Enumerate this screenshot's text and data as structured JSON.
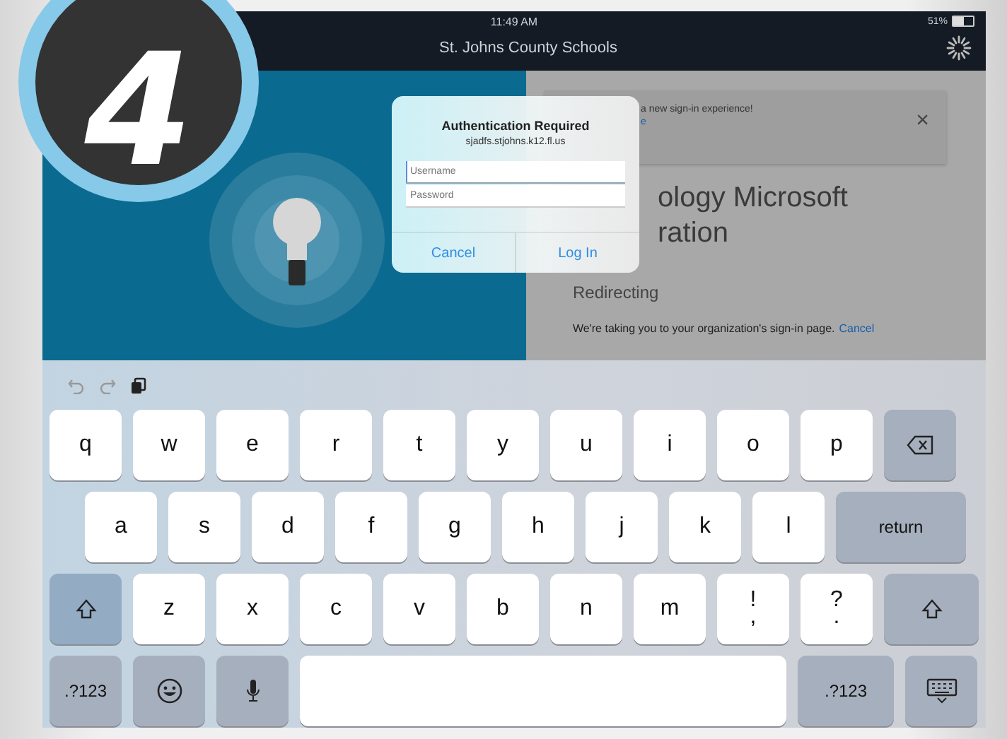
{
  "badge": {
    "label": "4"
  },
  "status_bar": {
    "time": "11:49 AM",
    "battery": "51%"
  },
  "browser": {
    "title": "St. Johns County Schools"
  },
  "page": {
    "banner": {
      "text": "a new sign-in experience!",
      "link": "e",
      "close": "×"
    },
    "heading_lines": [
      "ology Microsoft",
      "ration"
    ],
    "status": "Redirecting",
    "message": "We're taking you to your organization's sign-in page.",
    "cancel_link": "Cancel"
  },
  "dialog": {
    "title": "Authentication Required",
    "host": "sjadfs.stjohns.k12.fl.us",
    "fields": [
      {
        "placeholder": "Username",
        "focused": true
      },
      {
        "placeholder": "Password",
        "focused": false
      }
    ],
    "buttons": [
      "Cancel",
      "Log In"
    ]
  },
  "keyboard": {
    "top_row": [
      {
        "kind": "letter",
        "label": "q"
      },
      {
        "kind": "letter",
        "label": "w"
      },
      {
        "kind": "letter",
        "label": "e"
      },
      {
        "kind": "letter",
        "label": "r"
      },
      {
        "kind": "letter",
        "label": "t"
      },
      {
        "kind": "letter",
        "label": "y"
      },
      {
        "kind": "letter",
        "label": "u"
      },
      {
        "kind": "letter",
        "label": "i"
      },
      {
        "kind": "letter",
        "label": "o"
      },
      {
        "kind": "letter",
        "label": "p"
      },
      {
        "kind": "backspace"
      }
    ],
    "home_row": [
      {
        "kind": "letter",
        "label": "a"
      },
      {
        "kind": "letter",
        "label": "s"
      },
      {
        "kind": "letter",
        "label": "d"
      },
      {
        "kind": "letter",
        "label": "f"
      },
      {
        "kind": "letter",
        "label": "g"
      },
      {
        "kind": "letter",
        "label": "h"
      },
      {
        "kind": "letter",
        "label": "j"
      },
      {
        "kind": "letter",
        "label": "k"
      },
      {
        "kind": "letter",
        "label": "l"
      },
      {
        "kind": "return",
        "label": "return"
      }
    ],
    "bottom_row": [
      {
        "kind": "shift"
      },
      {
        "kind": "letter",
        "label": "z"
      },
      {
        "kind": "letter",
        "label": "x"
      },
      {
        "kind": "letter",
        "label": "c"
      },
      {
        "kind": "letter",
        "label": "v"
      },
      {
        "kind": "letter",
        "label": "b"
      },
      {
        "kind": "letter",
        "label": "n"
      },
      {
        "kind": "letter",
        "label": "m"
      },
      {
        "kind": "punct",
        "label": "!",
        "label2": ","
      },
      {
        "kind": "punct",
        "label": "?",
        "label2": "."
      },
      {
        "kind": "shift"
      }
    ],
    "space_row": [
      {
        "kind": "mode",
        "label": ".?123"
      },
      {
        "kind": "emoji"
      },
      {
        "kind": "mic"
      },
      {
        "kind": "space"
      },
      {
        "kind": "mode",
        "label": ".?123"
      },
      {
        "kind": "hide"
      }
    ]
  }
}
